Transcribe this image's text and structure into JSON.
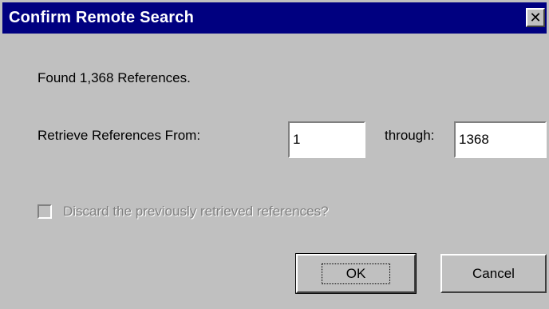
{
  "dialog": {
    "title": "Confirm Remote Search",
    "close_glyph": "✕",
    "found_text": "Found 1,368 References.",
    "from_label": "Retrieve References From:",
    "from_value": "1",
    "through_label": "through:",
    "through_value": "1368",
    "discard_label": "Discard the previously retrieved references?",
    "discard_checked": false,
    "discard_enabled": false,
    "ok_label": "OK",
    "cancel_label": "Cancel"
  },
  "colors": {
    "titlebar": "#000080",
    "face": "#c0c0c0",
    "disabled_text": "#808080"
  }
}
